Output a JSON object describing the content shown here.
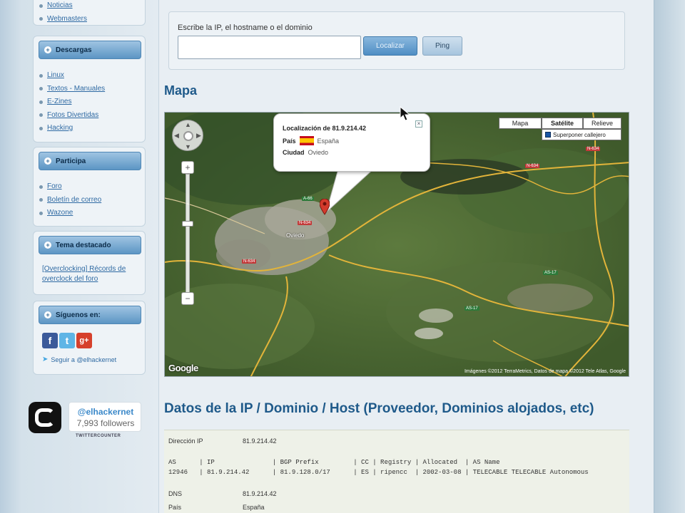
{
  "sidebar": {
    "top_items": [
      "Noticias",
      "Webmasters"
    ],
    "descargas": {
      "title": "Descargas",
      "items": [
        "Linux",
        "Textos - Manuales",
        "E-Zines",
        "Fotos Divertidas",
        "Hacking"
      ]
    },
    "participa": {
      "title": "Participa",
      "items": [
        "Foro",
        "Boletín de correo",
        "Wazone"
      ]
    },
    "tema": {
      "title": "Tema destacado",
      "link": "[Overclocking] Récords de overclock del foro"
    },
    "siguenos": {
      "title": "Síguenos en:",
      "icons": [
        "facebook-icon",
        "twitter-icon",
        "google-plus-icon"
      ],
      "follow_text": "Seguir a @elhackernet"
    },
    "counter": {
      "handle": "@elhackernet",
      "followers": "7,993 followers",
      "brand": "TWITTERCOUNTER"
    }
  },
  "form": {
    "label": "Escribe la IP, el hostname o el dominio",
    "input_value": "",
    "localizar_label": "Localizar",
    "ping_label": "Ping"
  },
  "map_section": {
    "title": "Mapa",
    "type_buttons": [
      "Mapa",
      "Satélite",
      "Relieve"
    ],
    "active_type": "Satélite",
    "overlay_label": "Superponer callejero",
    "popup": {
      "location": "Localización de 81.9.214.42",
      "pais_label": "País",
      "pais_value": "España",
      "ciudad_label": "Ciudad",
      "ciudad_value": "Oviedo"
    },
    "google_logo": "Google",
    "credit": "Imágenes ©2012 TerraMetrics, Datos de mapa ©2012 Tele Atlas, Google",
    "city_label": "Oviedo"
  },
  "datos_section": {
    "title": "Datos de la IP / Dominio / Host (Proveedor, Dominios alojados, etc)",
    "direccion_label": "Dirección IP",
    "direccion_value": "81.9.214.42",
    "header_line": "AS      | IP               | BGP Prefix         | CC | Registry | Allocated  | AS Name",
    "value_line": "12946   | 81.9.214.42      | 81.9.128.0/17      | ES | ripencc  | 2002-03-08 | TELECABLE TELECABLE Autonomous",
    "dns_label": "DNS",
    "dns_value": "81.9.214.42",
    "pais_label": "País",
    "pais_value": "España"
  },
  "colors": {
    "accent_blue": "#1f5a8a",
    "link_blue": "#2f6aa3",
    "header_blue": "#5c95c4"
  }
}
